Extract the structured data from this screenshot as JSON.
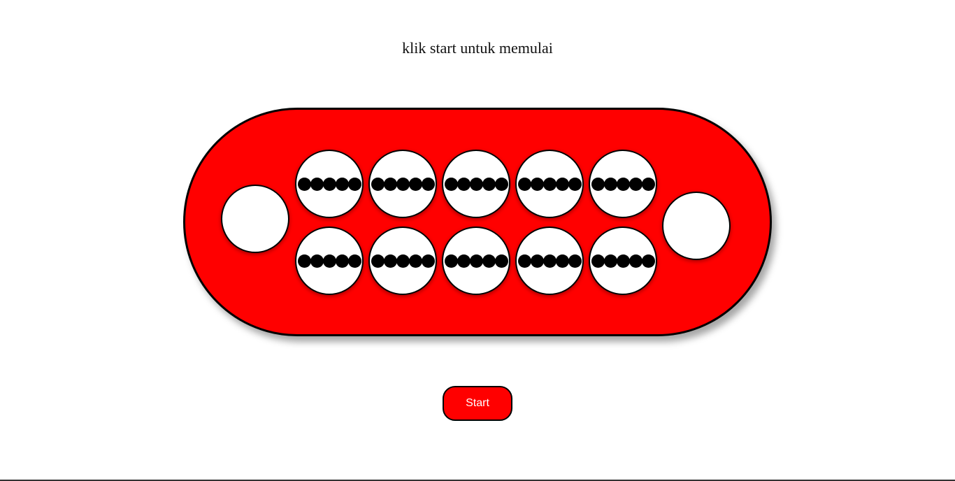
{
  "status": {
    "message": "klik start untuk memulai"
  },
  "board": {
    "color": "#ff0000",
    "top_row_seed_counts": [
      5,
      5,
      5,
      5,
      5
    ],
    "bottom_row_seed_counts": [
      5,
      5,
      5,
      5,
      5
    ],
    "left_store_count": 0,
    "right_store_count": 0
  },
  "controls": {
    "start_label": "Start",
    "start_color": "#ff0000"
  }
}
